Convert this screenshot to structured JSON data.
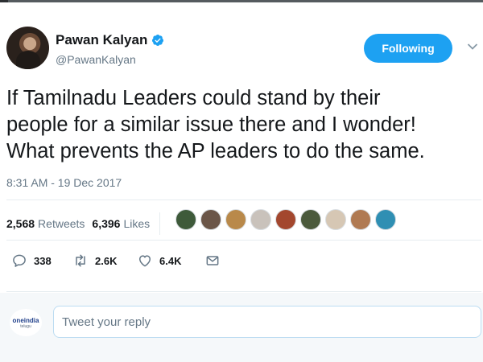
{
  "author": {
    "name": "Pawan Kalyan",
    "handle": "@PawanKalyan",
    "verified": true
  },
  "follow_button": {
    "label": "Following",
    "color": "#1da1f2"
  },
  "tweet": {
    "text": "If Tamilnadu Leaders could stand by their\npeople for a similar issue there and I wonder!\nWhat prevents the AP leaders to do the same.",
    "timestamp": "8:31 AM - 19 Dec 2017"
  },
  "stats": {
    "retweets_count": "2,568",
    "retweets_label": "Retweets",
    "likes_count": "6,396",
    "likes_label": "Likes"
  },
  "likers": [
    {
      "color": "#3e5a3a"
    },
    {
      "color": "#6b5648"
    },
    {
      "color": "#b9894a"
    },
    {
      "color": "#c9c2bb"
    },
    {
      "color": "#a3472e"
    },
    {
      "color": "#4b5a3c"
    },
    {
      "color": "#d6c7b4"
    },
    {
      "color": "#b07a52"
    },
    {
      "color": "#2f8fb3"
    }
  ],
  "actions": {
    "reply_icon": "reply-icon",
    "reply_count": "338",
    "retweet_icon": "retweet-icon",
    "retweet_count": "2.6K",
    "like_icon": "heart-icon",
    "like_count": "6.4K",
    "dm_icon": "envelope-icon"
  },
  "reply_box": {
    "placeholder": "Tweet your reply",
    "logo_brand": "oneindia",
    "logo_sub": "telugu"
  },
  "colors": {
    "accent": "#1da1f2",
    "secondary_text": "#657786",
    "divider": "#e6ecf0",
    "reply_bg": "#f5f8fa"
  }
}
